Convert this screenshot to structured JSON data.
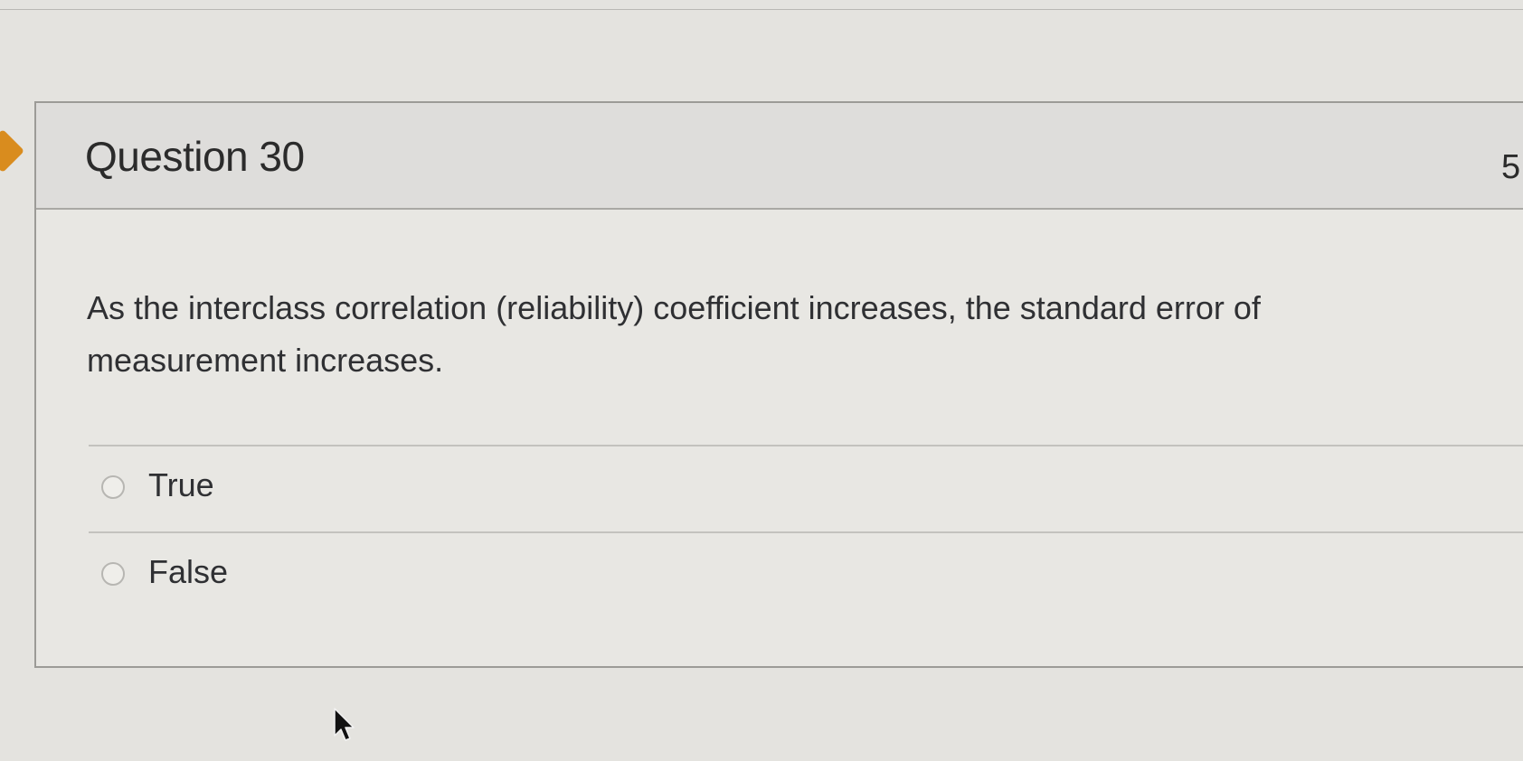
{
  "question": {
    "title": "Question 30",
    "points": "5",
    "text": "As the interclass correlation (reliability) coefficient increases, the standard error of measurement increases.",
    "answers": [
      {
        "label": "True",
        "selected": false
      },
      {
        "label": "False",
        "selected": false
      }
    ]
  },
  "colors": {
    "marker": "#d98c1e",
    "text": "#2f3033",
    "border": "#9c9b97"
  },
  "icons": {
    "marker": "current-question-flag-icon",
    "cursor": "mouse-pointer-icon",
    "radio": "radio-empty-icon"
  }
}
